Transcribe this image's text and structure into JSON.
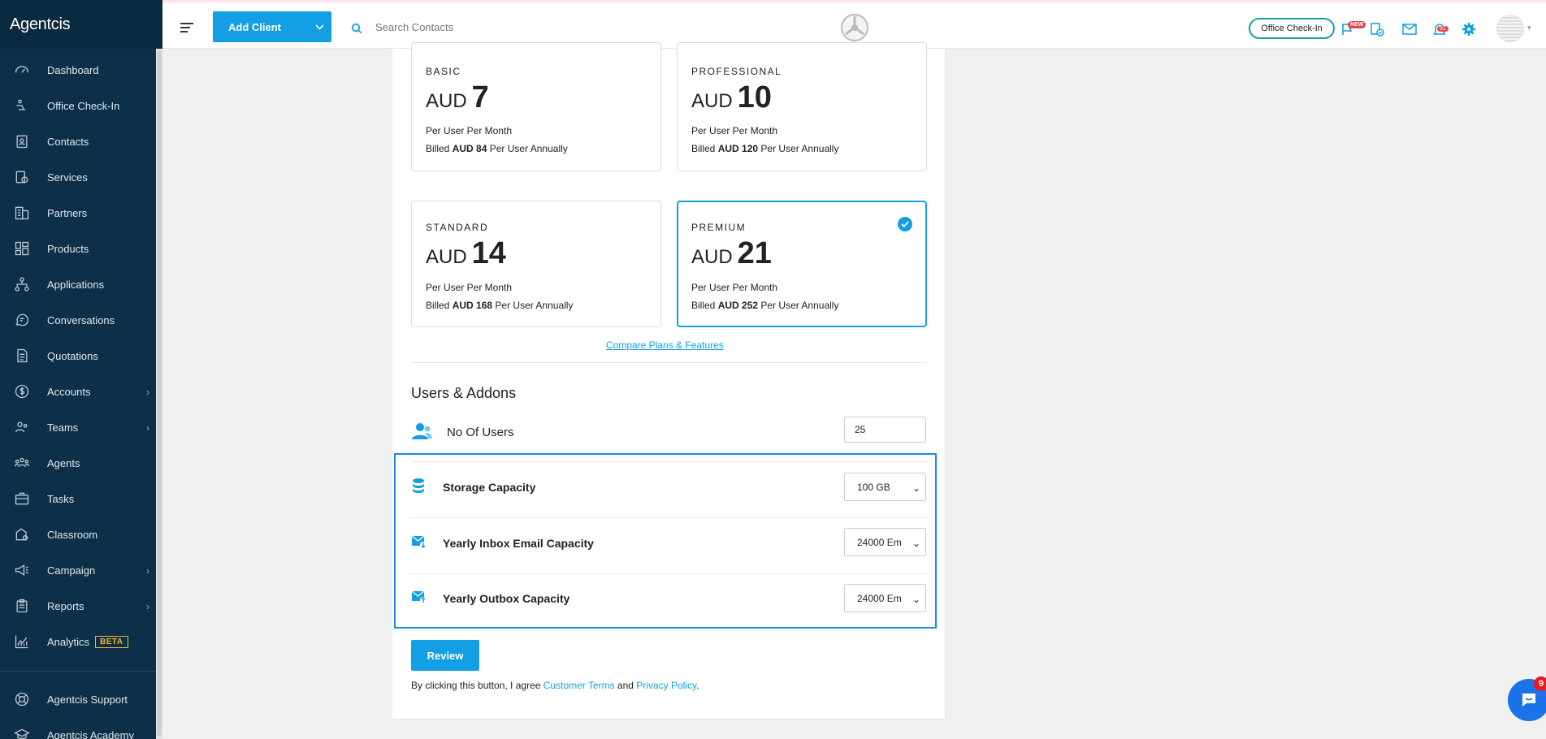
{
  "app": {
    "brand": "Agentcis"
  },
  "sidebar": {
    "items": [
      {
        "label": "Dashboard",
        "icon": "gauge-icon",
        "chevron": false
      },
      {
        "label": "Office Check-In",
        "icon": "office-checkin-icon",
        "chevron": false
      },
      {
        "label": "Contacts",
        "icon": "contacts-icon",
        "chevron": false
      },
      {
        "label": "Services",
        "icon": "services-icon",
        "chevron": false
      },
      {
        "label": "Partners",
        "icon": "building-icon",
        "chevron": false
      },
      {
        "label": "Products",
        "icon": "products-icon",
        "chevron": false
      },
      {
        "label": "Applications",
        "icon": "applications-icon",
        "chevron": false
      },
      {
        "label": "Conversations",
        "icon": "chat-icon",
        "chevron": false
      },
      {
        "label": "Quotations",
        "icon": "document-icon",
        "chevron": false
      },
      {
        "label": "Accounts",
        "icon": "dollar-icon",
        "chevron": true
      },
      {
        "label": "Teams",
        "icon": "team-icon",
        "chevron": true
      },
      {
        "label": "Agents",
        "icon": "agents-icon",
        "chevron": false
      },
      {
        "label": "Tasks",
        "icon": "briefcase-icon",
        "chevron": false
      },
      {
        "label": "Classroom",
        "icon": "classroom-icon",
        "chevron": false
      },
      {
        "label": "Campaign",
        "icon": "megaphone-icon",
        "chevron": true
      },
      {
        "label": "Reports",
        "icon": "clipboard-icon",
        "chevron": true
      },
      {
        "label": "Analytics",
        "icon": "analytics-icon",
        "chevron": false,
        "badge": "BETA"
      }
    ],
    "footer": [
      {
        "label": "Agentcis Support",
        "icon": "support-icon"
      },
      {
        "label": "Agentcis Academy",
        "icon": "academy-icon"
      }
    ]
  },
  "topbar": {
    "add_client_label": "Add Client",
    "search_placeholder": "Search Contacts",
    "checkin_label": "Office Check-In",
    "new_badge": "NEW",
    "notif_count": "91"
  },
  "plans": [
    {
      "name": "BASIC",
      "currency": "AUD",
      "amount": "7",
      "per": "Per User Per Month",
      "billed_prefix": "Billed",
      "billed_amount": "AUD 84",
      "billed_suffix": "Per User Annually",
      "selected": false
    },
    {
      "name": "PROFESSIONAL",
      "currency": "AUD",
      "amount": "10",
      "per": "Per User Per Month",
      "billed_prefix": "Billed",
      "billed_amount": "AUD 120",
      "billed_suffix": "Per User Annually",
      "selected": false
    },
    {
      "name": "STANDARD",
      "currency": "AUD",
      "amount": "14",
      "per": "Per User Per Month",
      "billed_prefix": "Billed",
      "billed_amount": "AUD 168",
      "billed_suffix": "Per User Annually",
      "selected": false
    },
    {
      "name": "PREMIUM",
      "currency": "AUD",
      "amount": "21",
      "per": "Per User Per Month",
      "billed_prefix": "Billed",
      "billed_amount": "AUD 252",
      "billed_suffix": "Per User Annually",
      "selected": true
    }
  ],
  "compare_link": "Compare Plans & Features",
  "addons": {
    "title": "Users & Addons",
    "users_label": "No Of Users",
    "users_value": "25",
    "storage_label": "Storage Capacity",
    "storage_value": "100 GB",
    "inbox_label": "Yearly Inbox Email Capacity",
    "inbox_value": "24000 Em",
    "outbox_label": "Yearly Outbox Capacity",
    "outbox_value": "24000 Em"
  },
  "review_label": "Review",
  "terms": {
    "prefix": "By clicking this button, I agree",
    "customer_terms": "Customer Terms",
    "and": "and",
    "privacy": "Privacy Policy",
    "end": "."
  },
  "chat_badge": "9",
  "colors": {
    "sidebar": "#0d3048",
    "accent": "#129fe4",
    "highlight": "#1e88e5",
    "badge": "#e8424c"
  }
}
